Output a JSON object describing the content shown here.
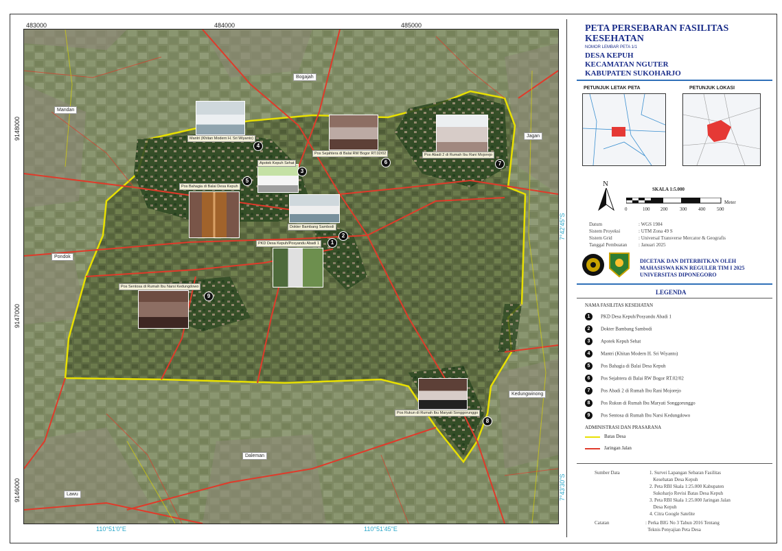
{
  "map": {
    "grid_top": [
      "483000",
      "484000",
      "485000"
    ],
    "grid_left": [
      "9148000",
      "9147000",
      "9146000"
    ],
    "grid_bottom": [
      "110°51'0\"E",
      "110°51'45\"E"
    ],
    "grid_right": [
      "7°42'45\"S",
      "7°43'30\"S"
    ],
    "places": {
      "bogajah": "Bogajah",
      "mandan": "Mandan",
      "jagan": "Jagan",
      "pondok": "Pondok",
      "kedungwinong": "Kedungwinong",
      "daleman": "Daleman",
      "lawu": "Lawu"
    },
    "facility_labels": {
      "f1": "PKD Desa Kepuh/Posyandu Abadi 1",
      "f2": "Dokter Bambang Sambodi",
      "f3": "Apotek Kepuh Sehat",
      "f4": "Mantri (Khitan Modern H. Sri Wiyanto)",
      "f5": "Pos Bahagia di Balai Desa Kepuh",
      "f6": "Pos Sejahtera di Balai RW Bogor RT.02/02",
      "f7": "Pos Abadi 2 di Rumah Ibu Rani Mojorejo",
      "f8": "Pos Rukun di Rumah Ibu Maryati Songgorunggo",
      "f9": "Pos Sentosa di Rumah Ibu Narsi Kedungdowo"
    }
  },
  "title": {
    "line1": "PETA PERSEBARAN FASILITAS",
    "line2": "KESEHATAN",
    "sheet_no": "NOMOR LEMBAR PETA 1/1",
    "desa": "DESA KEPUH",
    "kecamatan": "KECAMATAN NGUTER",
    "kabupaten": "KABUPATEN SUKOHARJO"
  },
  "inset": {
    "letak_title": "PETUNJUK LETAK PETA",
    "lokasi_title": "PETUNJUK LOKASI"
  },
  "scale": {
    "label": "SKALA   1:5.000",
    "ticks": [
      "0",
      "100",
      "200",
      "300",
      "400",
      "500"
    ],
    "unit": "Meter",
    "north": "N"
  },
  "meta": {
    "rows": [
      {
        "k": "Datum",
        "v": ": WGS 1984"
      },
      {
        "k": "Sistem Proyeksi",
        "v": ": UTM Zona 49 S"
      },
      {
        "k": "Sistem Grid",
        "v": ": Universal Transverse Mercator & Geografis"
      },
      {
        "k": "Tanggal Pembuatan",
        "v": ": Januari 2025"
      }
    ]
  },
  "publisher": {
    "line1": "DICETAK DAN DITERBITKAN OLEH",
    "line2": "MAHASISWA KKN REGULER TIM I 2025",
    "line3": "UNIVERSITAS DIPONEGORO"
  },
  "legend": {
    "head": "LEGENDA",
    "sub1": "NAMA FASILITAS KESEHATAN",
    "items": [
      {
        "n": "1",
        "t": "PKD Desa Kepuh/Posyandu Abadi 1"
      },
      {
        "n": "2",
        "t": "Dokter Bambang Sambodi"
      },
      {
        "n": "3",
        "t": "Apotek Kepuh Sehat"
      },
      {
        "n": "4",
        "t": "Mantri (Khitan Modern H. Sri Wiyanto)"
      },
      {
        "n": "5",
        "t": "Pos Bahagia di Balai Desa Kepuh"
      },
      {
        "n": "6",
        "t": "Pos Sejahtera di Balai RW Bogor RT.02/02"
      },
      {
        "n": "7",
        "t": "Pos Abadi 2 di Rumah Ibu Rani Mojorejo"
      },
      {
        "n": "8",
        "t": "Pos Rukun di Rumah Ibu Maryati Songgorunggo"
      },
      {
        "n": "9",
        "t": "Pos Sentosa di Rumah Ibu Narsi Kedungdowo"
      }
    ],
    "sub2": "ADMINISTRASI DAN PRASARANA",
    "batas": "Batas Desa",
    "jalan": "Jaringan Jalan",
    "colors": {
      "batas": "#e8e000",
      "jalan": "#e03a2a"
    }
  },
  "sources": {
    "label": "Sumber Data",
    "items": [
      "1. Survei Lapangan Sebaran Fasilitas",
      "   Kesehatan Desa Kepuh",
      "2. Peta RBI Skala 1:25.000 Kabupaten",
      "   Sukoharjo Revisi Batas Desa Kepuh",
      "3. Peta RBI Skala 1:25.000 Jaringan Jalan",
      "   Desa Kepuh",
      "4. Citra Google Satelite"
    ],
    "note_label": "Catatan",
    "note": [
      ": Perka BIG No 3 Tahun 2016 Tentang",
      "  Teknis Penyajian Peta Desa"
    ]
  }
}
